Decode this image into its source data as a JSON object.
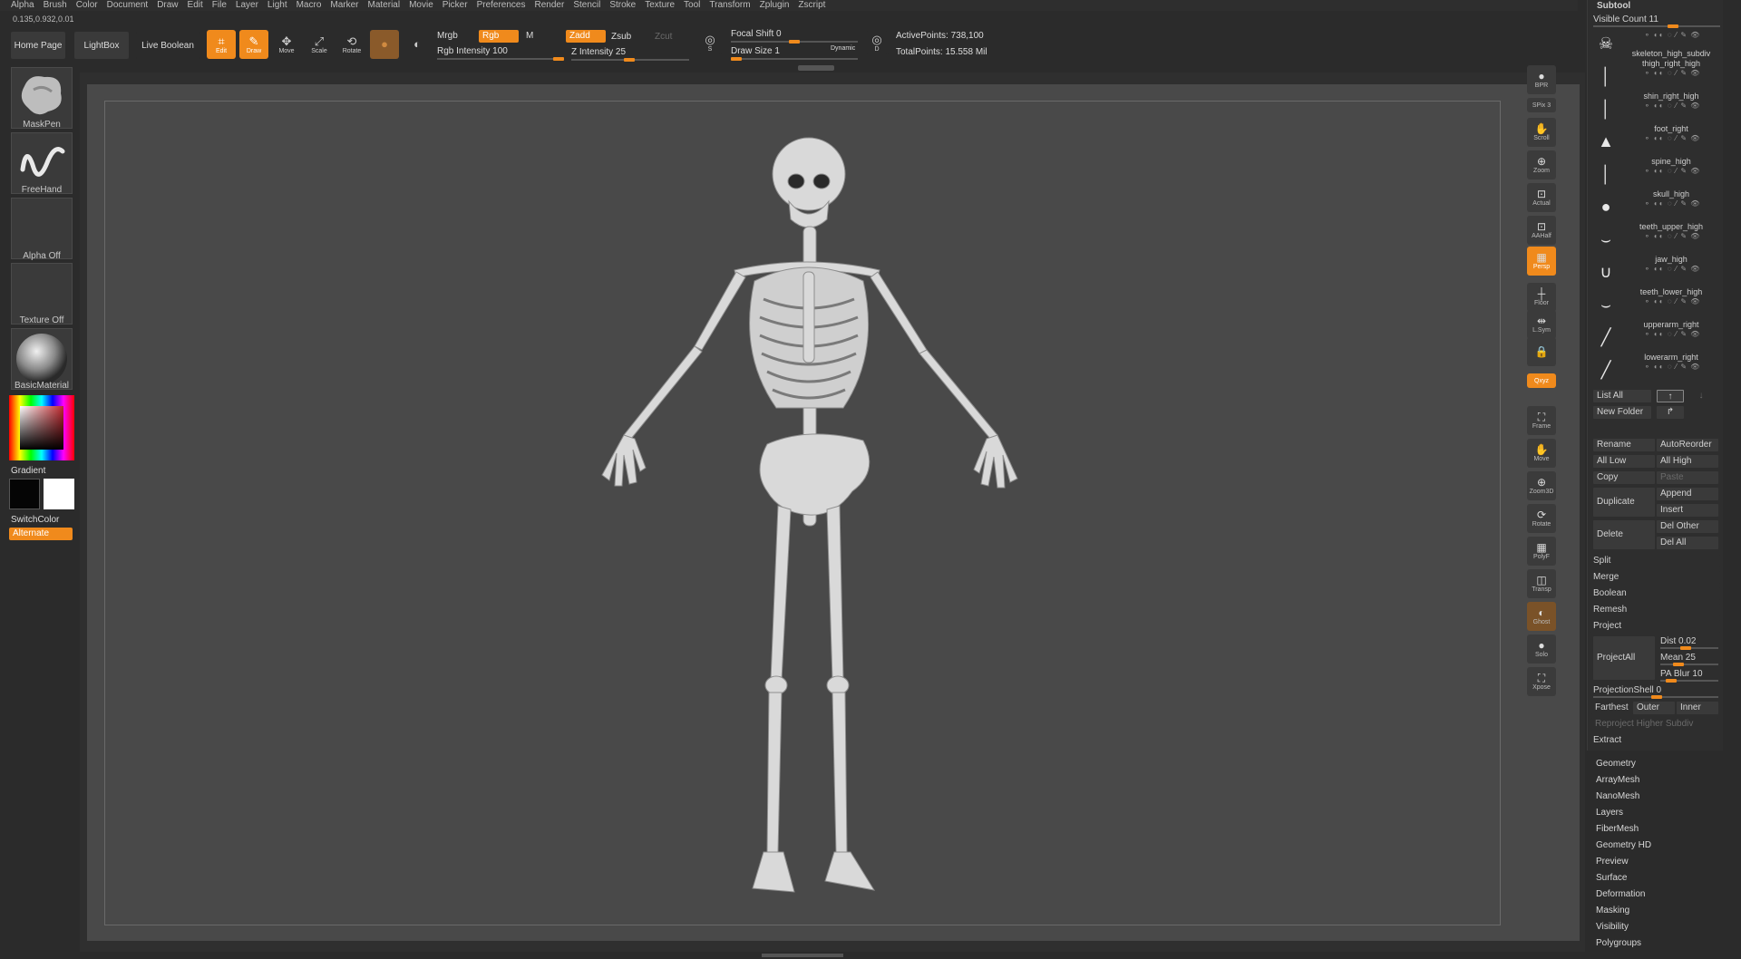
{
  "menu": [
    "Alpha",
    "Brush",
    "Color",
    "Document",
    "Draw",
    "Edit",
    "File",
    "Layer",
    "Light",
    "Macro",
    "Marker",
    "Material",
    "Movie",
    "Picker",
    "Preferences",
    "Render",
    "Stencil",
    "Stroke",
    "Texture",
    "Tool",
    "Transform",
    "Zplugin",
    "Zscript"
  ],
  "coords": "0.135,0.932,0.01",
  "toolbar": {
    "home": "Home Page",
    "lightbox": "LightBox",
    "live_boolean": "Live Boolean",
    "edit": "Edit",
    "draw": "Draw",
    "move": "Move",
    "scale": "Scale",
    "rotate": "Rotate",
    "mrgb": "Mrgb",
    "rgb": "Rgb",
    "m": "M",
    "zadd": "Zadd",
    "zsub": "Zsub",
    "zcut": "Zcut",
    "rgb_intensity_label": "Rgb Intensity",
    "rgb_intensity_value": "100",
    "z_intensity_label": "Z Intensity",
    "z_intensity_value": "25",
    "focal_shift_label": "Focal Shift",
    "focal_shift_value": "0",
    "draw_size_label": "Draw Size",
    "draw_size_value": "1",
    "dynamic": "Dynamic",
    "active_points": "ActivePoints: 738,100",
    "total_points": "TotalPoints: 15.558 Mil",
    "s": "S",
    "d": "D"
  },
  "left": {
    "brush": "MaskPen",
    "stroke": "FreeHand",
    "alpha": "Alpha Off",
    "texture": "Texture Off",
    "material": "BasicMaterial",
    "gradient": "Gradient",
    "switchcolor": "SwitchColor",
    "alternate": "Alternate"
  },
  "right_shelf": [
    {
      "name": "bpr",
      "label": "BPR",
      "glyph": "●"
    },
    {
      "name": "spix",
      "label": "SPix 3",
      "glyph": ""
    },
    {
      "name": "scroll",
      "label": "Scroll",
      "glyph": "✋"
    },
    {
      "name": "zoom",
      "label": "Zoom",
      "glyph": "⊕"
    },
    {
      "name": "actual",
      "label": "Actual",
      "glyph": "⊡"
    },
    {
      "name": "aahalf",
      "label": "AAHalf",
      "glyph": "⊡"
    },
    {
      "name": "persp",
      "label": "Persp",
      "glyph": "▦"
    },
    {
      "name": "floor",
      "label": "Floor",
      "glyph": "┼"
    },
    {
      "name": "lsym",
      "label": "L.Sym",
      "glyph": "⇹"
    },
    {
      "name": "lock",
      "label": "",
      "glyph": "🔒"
    },
    {
      "name": "xyz",
      "label": "Qxyz",
      "glyph": ""
    },
    {
      "name": "frame",
      "label": "Frame",
      "glyph": "⛶"
    },
    {
      "name": "move",
      "label": "Move",
      "glyph": "✋"
    },
    {
      "name": "zoom3d",
      "label": "Zoom3D",
      "glyph": "⊕"
    },
    {
      "name": "rotate",
      "label": "Rotate",
      "glyph": "⟳"
    },
    {
      "name": "polyf",
      "label": "PolyF",
      "glyph": "▦"
    },
    {
      "name": "transp",
      "label": "Transp",
      "glyph": "◫"
    },
    {
      "name": "ghost",
      "label": "Ghost",
      "glyph": "◐"
    },
    {
      "name": "solo",
      "label": "Solo",
      "glyph": "●"
    },
    {
      "name": "xpose",
      "label": "Xpose",
      "glyph": "⛶"
    }
  ],
  "subtool": {
    "title": "Subtool",
    "visible_count_label": "Visible Count",
    "visible_count": "11",
    "items": [
      {
        "name": "skeleton_high_subdiv",
        "glyph": "☠"
      },
      {
        "name": "thigh_right_high",
        "glyph": "│"
      },
      {
        "name": "shin_right_high",
        "glyph": "│"
      },
      {
        "name": "foot_right",
        "glyph": "▲"
      },
      {
        "name": "spine_high",
        "glyph": "│"
      },
      {
        "name": "skull_high",
        "glyph": "●"
      },
      {
        "name": "teeth_upper_high",
        "glyph": "⌣"
      },
      {
        "name": "jaw_high",
        "glyph": "∪"
      },
      {
        "name": "teeth_lower_high",
        "glyph": "⌣"
      },
      {
        "name": "upperarm_right",
        "glyph": "╱"
      },
      {
        "name": "lowerarm_right",
        "glyph": "╱"
      }
    ],
    "list_all": "List All",
    "new_folder": "New Folder",
    "rename": "Rename",
    "autoreorder": "AutoReorder",
    "all_low": "All Low",
    "all_high": "All High",
    "copy": "Copy",
    "paste": "Paste",
    "duplicate": "Duplicate",
    "append": "Append",
    "insert": "Insert",
    "delete": "Delete",
    "del_other": "Del Other",
    "del_all": "Del All",
    "split": "Split",
    "merge": "Merge",
    "boolean": "Boolean",
    "remesh": "Remesh",
    "project": "Project",
    "projectall": "ProjectAll",
    "dist_label": "Dist",
    "dist": "0.02",
    "mean_label": "Mean",
    "mean": "25",
    "pablur_label": "PA Blur",
    "pablur": "10",
    "projshell_label": "ProjectionShell",
    "projshell": "0",
    "farthest": "Farthest",
    "outer": "Outer",
    "inner": "Inner",
    "reproject": "Reproject Higher Subdiv",
    "extract": "Extract"
  },
  "sections": [
    "Geometry",
    "ArrayMesh",
    "NanoMesh",
    "Layers",
    "FiberMesh",
    "Geometry HD",
    "Preview",
    "Surface",
    "Deformation",
    "Masking",
    "Visibility",
    "Polygroups"
  ],
  "colors": {
    "accent": "#f08a1c",
    "canvas": "#494949",
    "panel": "#2e2e2e"
  }
}
